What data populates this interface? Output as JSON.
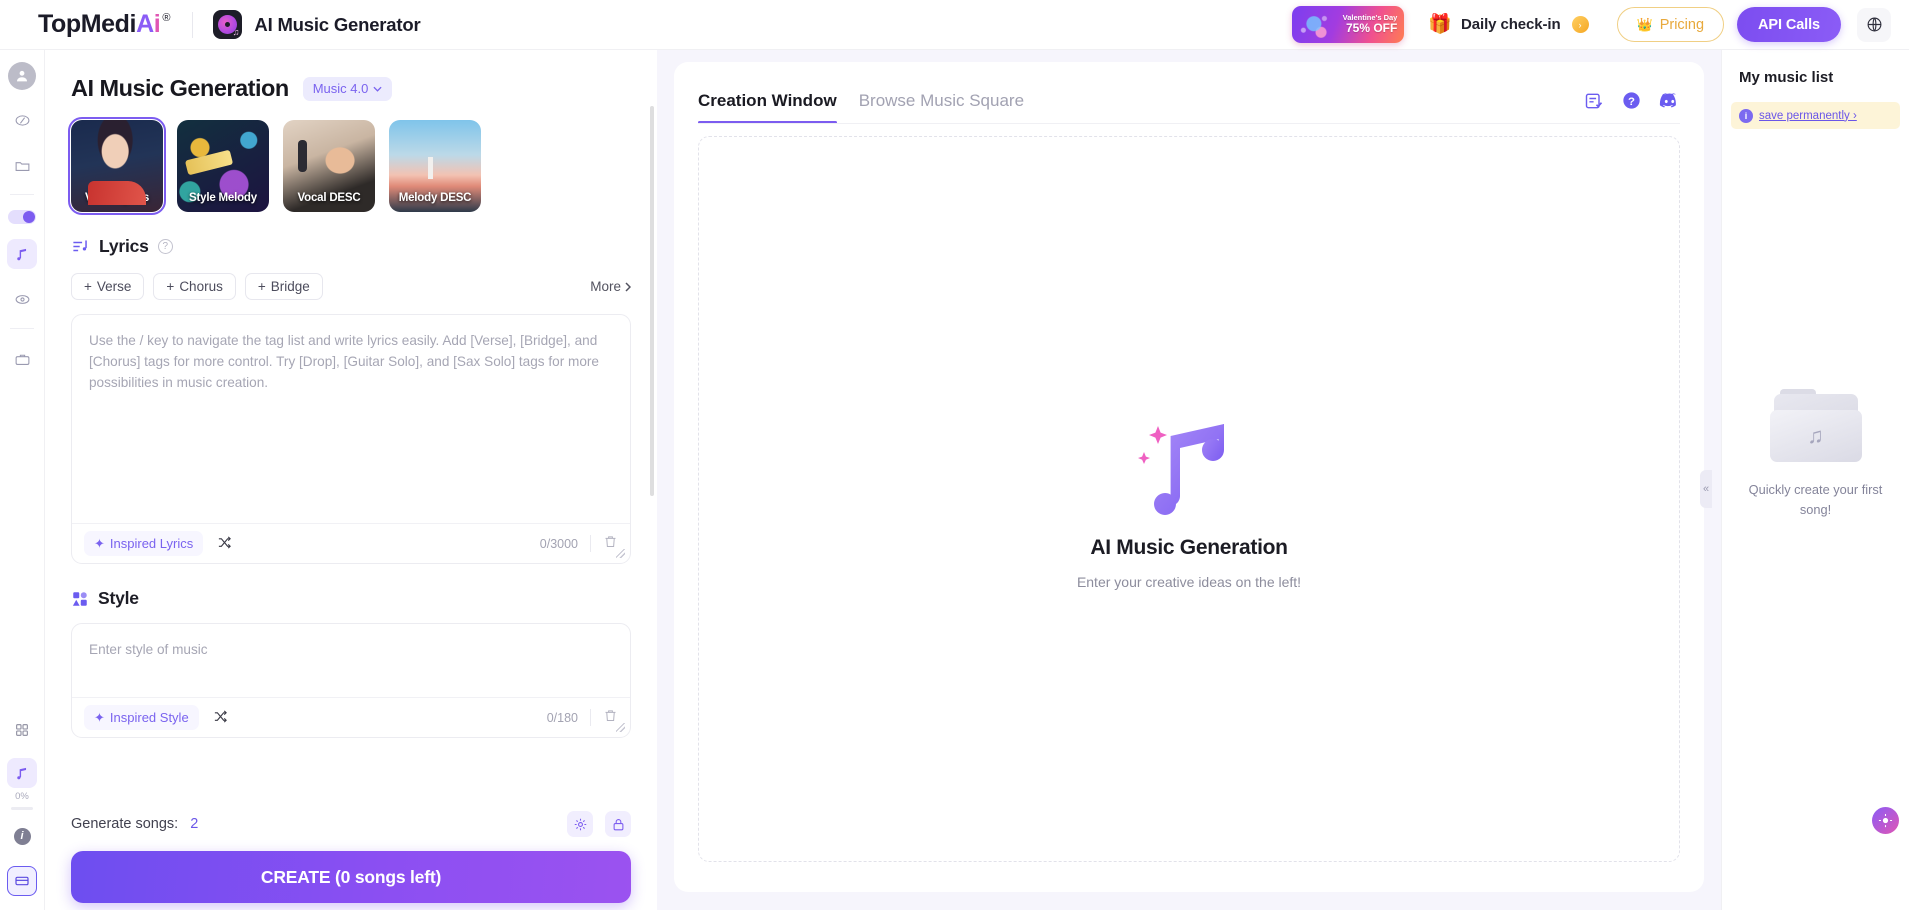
{
  "header": {
    "logo": {
      "prefix": "TopMedi",
      "accent_a": "A",
      "accent_i": "i",
      "registered": "®"
    },
    "app_title": "AI Music Generator",
    "promo": {
      "line1": "Valentine's Day",
      "line2": "75% OFF"
    },
    "checkin": {
      "label": "Daily check-in",
      "gift_icon": "gift-icon",
      "arrow": "›"
    },
    "pricing": {
      "label": "Pricing",
      "icon": "crown-icon"
    },
    "api_calls": {
      "label": "API Calls"
    },
    "language": {
      "icon": "globe-icon"
    }
  },
  "rail": {
    "items": [
      {
        "name": "account-avatar",
        "icon": "user-icon"
      },
      {
        "name": "image-edit",
        "icon": "image-edit-icon"
      },
      {
        "name": "folder",
        "icon": "folder-icon"
      },
      {
        "name": "toggle",
        "icon": "toggle-on-icon"
      },
      {
        "name": "music",
        "icon": "music-note-icon"
      },
      {
        "name": "eye",
        "icon": "eye-icon"
      },
      {
        "name": "briefcase",
        "icon": "briefcase-icon"
      },
      {
        "name": "apps-grid",
        "icon": "grid-icon"
      },
      {
        "name": "music-progress",
        "icon": "music-note-icon"
      },
      {
        "name": "info",
        "icon": "info-icon"
      },
      {
        "name": "card",
        "icon": "card-icon"
      }
    ],
    "progress_label": "0%"
  },
  "panel": {
    "title": "AI Music Generation",
    "version": {
      "label": "Music 4.0",
      "chevron": "⌄"
    },
    "modes": [
      {
        "label": "Vocal Lyrics",
        "selected": true
      },
      {
        "label": "Style Melody",
        "selected": false
      },
      {
        "label": "Vocal DESC",
        "selected": false
      },
      {
        "label": "Melody DESC",
        "selected": false
      }
    ],
    "lyrics": {
      "section_title": "Lyrics",
      "help_icon": "question-mark-icon",
      "tags": [
        "Verse",
        "Chorus",
        "Bridge"
      ],
      "tag_prefix": "+",
      "more_label": "More",
      "more_chevron": "›",
      "placeholder": "Use the / key to navigate the tag list and write lyrics easily. Add [Verse], [Bridge], and [Chorus] tags for more control. Try [Drop], [Guitar Solo], and [Sax Solo] tags for more possibilities in music creation.",
      "inspire_label": "Inspired Lyrics",
      "counter": "0/3000",
      "shuffle_icon": "shuffle-icon",
      "trash_icon": "trash-icon"
    },
    "style": {
      "section_title": "Style",
      "placeholder": "Enter style of music",
      "inspire_label": "Inspired Style",
      "counter": "0/180",
      "shuffle_icon": "shuffle-icon",
      "trash_icon": "trash-icon"
    },
    "footer": {
      "generate_label": "Generate songs:",
      "generate_value": "2",
      "settings_icon": "gear-icon",
      "lock_icon": "lock-icon",
      "create_label": "CREATE (0 songs left)"
    }
  },
  "main": {
    "tabs": [
      {
        "label": "Creation Window",
        "active": true
      },
      {
        "label": "Browse Music Square",
        "active": false
      }
    ],
    "tab_icons": [
      {
        "name": "list-check-icon"
      },
      {
        "name": "help-circle-icon"
      },
      {
        "name": "discord-icon"
      }
    ],
    "empty": {
      "title": "AI Music Generation",
      "subtitle": "Enter your creative ideas on the left!",
      "art": "music-note-sparkle-art"
    }
  },
  "right": {
    "title": "My music list",
    "save_banner": {
      "icon": "info-icon",
      "link": "save permanently ›"
    },
    "empty_line1": "Quickly create your",
    "empty_line2": "first song!",
    "folder_art": "empty-folder-icon"
  },
  "collapse": {
    "icon": "«"
  },
  "fab": {
    "icon": "assistant-icon"
  },
  "colors": {
    "accent": "#7c5cf0",
    "accent_pink": "#e056b4",
    "gold": "#e8a93c",
    "banner_bg": "#fdf4d8",
    "canvas_bg": "#f6f5fc"
  }
}
